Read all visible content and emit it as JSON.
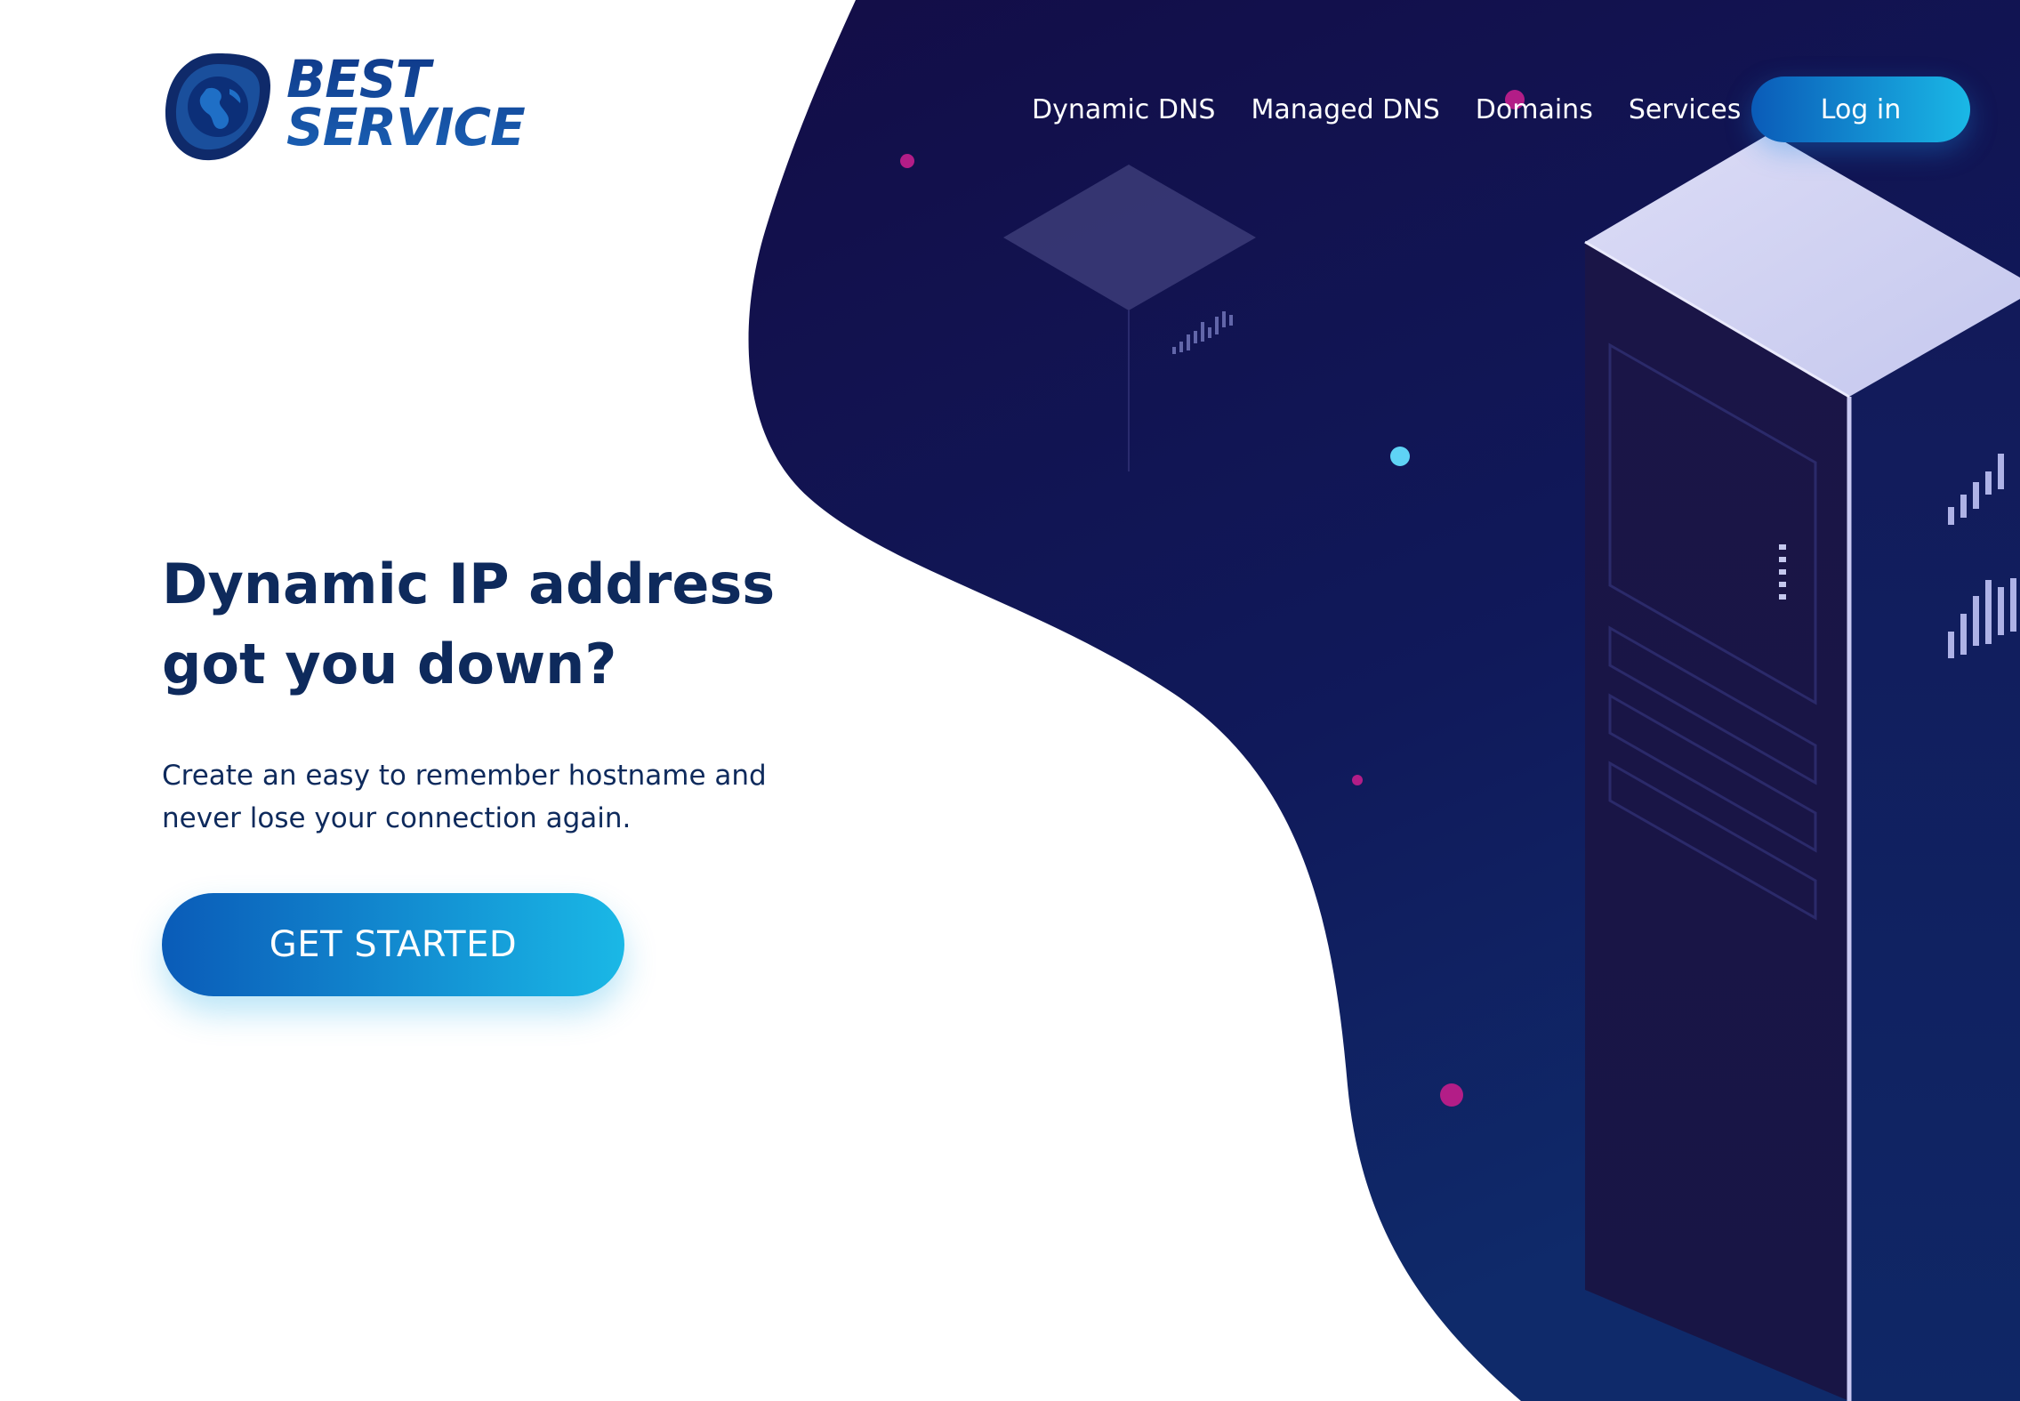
{
  "brand": {
    "line1": "BEST",
    "line2": "SERVICE"
  },
  "nav": {
    "items": [
      "Dynamic DNS",
      "Managed DNS",
      "Domains",
      "Services"
    ],
    "login_label": "Log in"
  },
  "hero": {
    "title_line1": "Dynamic IP address",
    "title_line2": "got you down?",
    "subtitle_line1": "Create an easy to remember hostname and",
    "subtitle_line2": "never lose your connection again.",
    "cta_label": "GET STARTED"
  },
  "colors": {
    "accent_start": "#0a5bb8",
    "accent_end": "#1ab8e6",
    "navy_bg": "#13124a",
    "heading": "#0e2a5c"
  },
  "icons": {
    "logo": "globe-shield-icon"
  }
}
